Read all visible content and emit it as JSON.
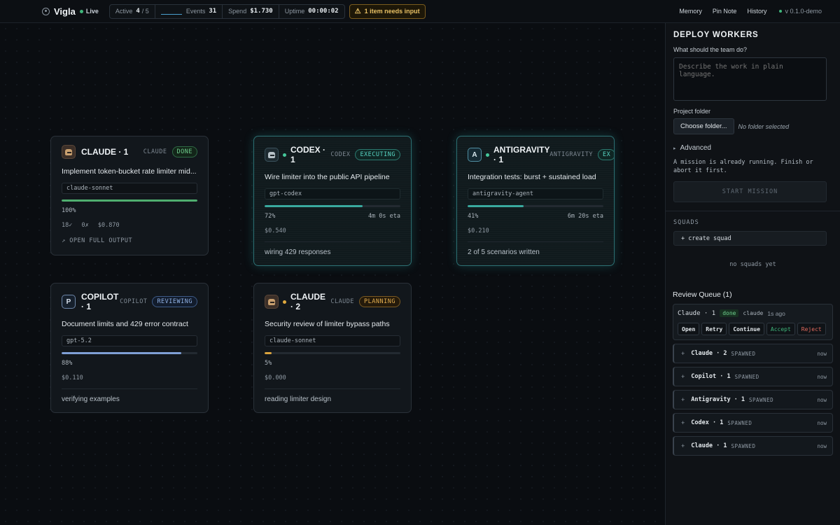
{
  "app": {
    "name": "Vigla",
    "live_label": "Live",
    "version": "v 0.1.0-demo"
  },
  "stats": {
    "active_label": "Active",
    "active_value": "4",
    "active_total": "/ 5",
    "events_label": "Events",
    "events_value": "31",
    "spend_label": "Spend",
    "spend_value": "$1.730",
    "uptime_label": "Uptime",
    "uptime_value": "00:00:02"
  },
  "alert": {
    "text": "1 item needs input",
    "icon": "warning-icon"
  },
  "nav": {
    "memory": "Memory",
    "pin_note": "Pin Note",
    "history": "History"
  },
  "cards": [
    {
      "name": "CLAUDE · 1",
      "kind": "CLAUDE",
      "status": "DONE",
      "task": "Implement token-bucket rate limiter mid...",
      "model": "claude-sonnet",
      "progress": 1.0,
      "percent": "100%",
      "checks": "18✓",
      "fails": "0✗",
      "cost": "$0.870",
      "link": "↗ OPEN FULL OUTPUT",
      "avatar_icon": "claude-avatar-icon"
    },
    {
      "name": "CODEX · 1",
      "kind": "CODEX",
      "status": "EXECUTING",
      "task": "Wire limiter into the public API pipeline",
      "model": "gpt-codex",
      "progress": 0.72,
      "percent": "72%",
      "eta": "4m 0s eta",
      "cost": "$0.540",
      "note": "wiring 429 responses",
      "avatar_icon": "codex-avatar-icon"
    },
    {
      "name": "ANTIGRAVITY · 1",
      "kind": "ANTIGRAVITY",
      "status": "EX",
      "task": "Integration tests: burst + sustained load",
      "model": "antigravity-agent",
      "progress": 0.41,
      "percent": "41%",
      "eta": "6m 20s eta",
      "cost": "$0.210",
      "note": "2 of 5 scenarios written",
      "avatar_letter": "A"
    },
    {
      "name": "COPILOT · 1",
      "kind": "COPILOT",
      "status": "REVIEWING",
      "task": "Document limits and 429 error contract",
      "model": "gpt-5.2",
      "progress": 0.88,
      "percent": "88%",
      "cost": "$0.110",
      "note": "verifying examples",
      "avatar_letter": "P"
    },
    {
      "name": "CLAUDE · 2",
      "kind": "CLAUDE",
      "status": "PLANNING",
      "task": "Security review of limiter bypass paths",
      "model": "claude-sonnet",
      "progress": 0.05,
      "percent": "5%",
      "cost": "$0.000",
      "note": "reading limiter design",
      "avatar_icon": "claude-avatar-icon"
    }
  ],
  "panel": {
    "title": "DEPLOY WORKERS",
    "prompt_label": "What should the team do?",
    "prompt_placeholder": "Describe the work in plain language.",
    "folder_label": "Project folder",
    "folder_button": "Choose folder...",
    "folder_note": "No folder selected",
    "advanced": "Advanced",
    "mission_note": "A mission is already running. Finish or abort it first.",
    "start_button": "START MISSION",
    "squads_title": "SQUADS",
    "create_squad": "+ create squad",
    "no_squads": "no squads yet"
  },
  "review_queue": {
    "title": "Review Queue (1)",
    "item": {
      "name": "Claude · 1",
      "status": "done",
      "kind": "claude",
      "time": "1s ago",
      "actions": [
        "Open",
        "Retry",
        "Continue",
        "Accept",
        "Reject"
      ]
    }
  },
  "spawned": [
    {
      "name": "Claude · 2",
      "tag": "SPAWNED",
      "when": "now"
    },
    {
      "name": "Copilot · 1",
      "tag": "SPAWNED",
      "when": "now"
    },
    {
      "name": "Antigravity · 1",
      "tag": "SPAWNED",
      "when": "now"
    },
    {
      "name": "Codex · 1",
      "tag": "SPAWNED",
      "when": "now"
    },
    {
      "name": "Claude · 1",
      "tag": "SPAWNED",
      "when": "now"
    }
  ],
  "colors": {
    "accent_teal": "#45c79a",
    "done_green": "#3fb67b",
    "progress_claude_done": "#4fae6f",
    "progress_exec": "#3aa99e",
    "progress_review": "#7f9fd6",
    "progress_plan": "#d9a33e",
    "warning": "#e8c064"
  }
}
